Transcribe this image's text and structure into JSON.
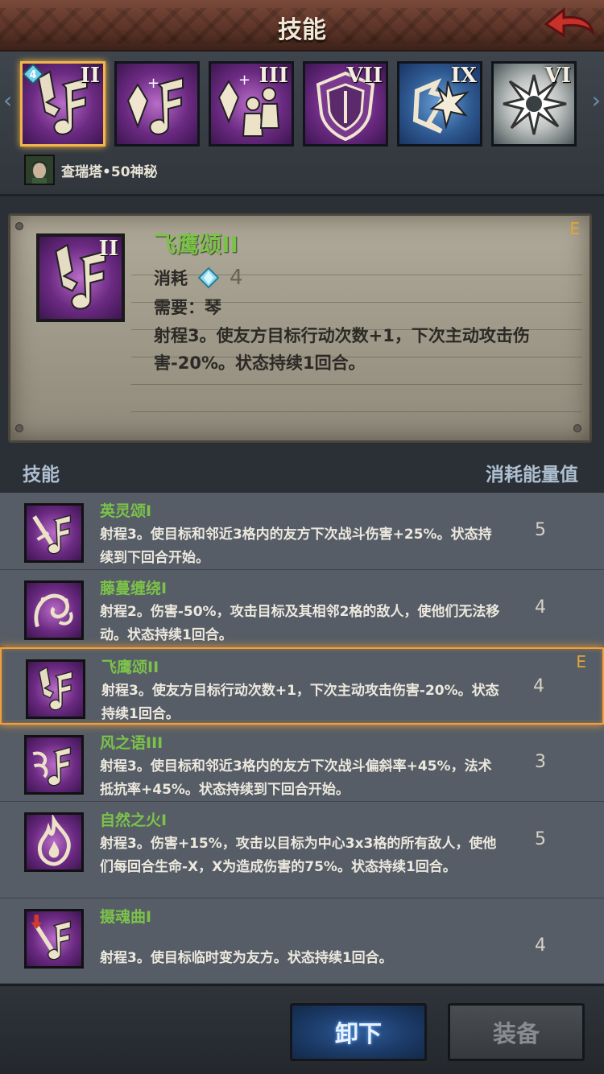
{
  "header": {
    "title": "技能",
    "back_icon": "back-arrow-icon"
  },
  "strip": {
    "slots": [
      {
        "roman": "II",
        "icon": "music-note-icon",
        "theme": "purple",
        "selected": true,
        "badge": "4"
      },
      {
        "roman": "",
        "icon": "crystal-music-icon",
        "theme": "purple",
        "selected": false
      },
      {
        "roman": "III",
        "icon": "crystal-people-icon",
        "theme": "purple",
        "selected": false
      },
      {
        "roman": "VII",
        "icon": "shield-icon",
        "theme": "purple",
        "selected": false
      },
      {
        "roman": "IX",
        "icon": "burst-icon",
        "theme": "blue",
        "selected": false
      },
      {
        "roman": "VI",
        "icon": "shatter-icon",
        "theme": "white",
        "selected": false
      }
    ],
    "owner": {
      "name": "查瑞塔•50神秘"
    }
  },
  "detail": {
    "title": "飞鹰颂II",
    "roman": "II",
    "grade": "E",
    "cost_label": "消耗",
    "cost_value": "4",
    "requirement": "需要：琴",
    "description": "射程3。使友方目标行动次数+1，下次主动攻击伤害-20%。状态持续1回合。"
  },
  "list": {
    "header_left": "技能",
    "header_right": "消耗能量值",
    "rows": [
      {
        "name": "英灵颂I",
        "desc": "射程3。使目标和邻近3格内的友方下次战斗伤害+25%。状态持续到下回合开始。",
        "cost": "5",
        "grade": "",
        "icon": "sword-note-icon",
        "selected": false
      },
      {
        "name": "藤蔓缠绕I",
        "desc": "射程2。伤害-50%，攻击目标及其相邻2格的敌人，使他们无法移动。状态持续1回合。",
        "cost": "4",
        "grade": "",
        "icon": "vine-icon",
        "selected": false
      },
      {
        "name": "飞鹰颂II",
        "desc": "射程3。使友方目标行动次数+1，下次主动攻击伤害-20%。状态持续1回合。",
        "cost": "4",
        "grade": "E",
        "icon": "music-note-icon",
        "selected": true
      },
      {
        "name": "风之语III",
        "desc": "射程3。使目标和邻近3格内的友方下次战斗偏斜率+45%，法术抵抗率+45%。状态持续到下回合开始。",
        "cost": "3",
        "grade": "",
        "icon": "wind-note-icon",
        "selected": false
      },
      {
        "name": "自然之火I",
        "desc": "射程3。伤害+15%，攻击以目标为中心3x3格的所有敌人，使他们每回合生命-X，X为造成伤害的75%。状态持续1回合。",
        "cost": "5",
        "grade": "",
        "icon": "fire-icon",
        "selected": false
      },
      {
        "name": "摄魂曲I",
        "desc": "射程3。使目标临时变为友方。状态持续1回合。",
        "cost": "4",
        "grade": "",
        "icon": "soul-note-icon",
        "selected": false
      }
    ]
  },
  "buttons": {
    "unequip": "卸下",
    "equip": "装备"
  },
  "colors": {
    "accent_green": "#7cc24a",
    "grade_orange": "#e3a633",
    "select_gold": "#f3a03a"
  }
}
